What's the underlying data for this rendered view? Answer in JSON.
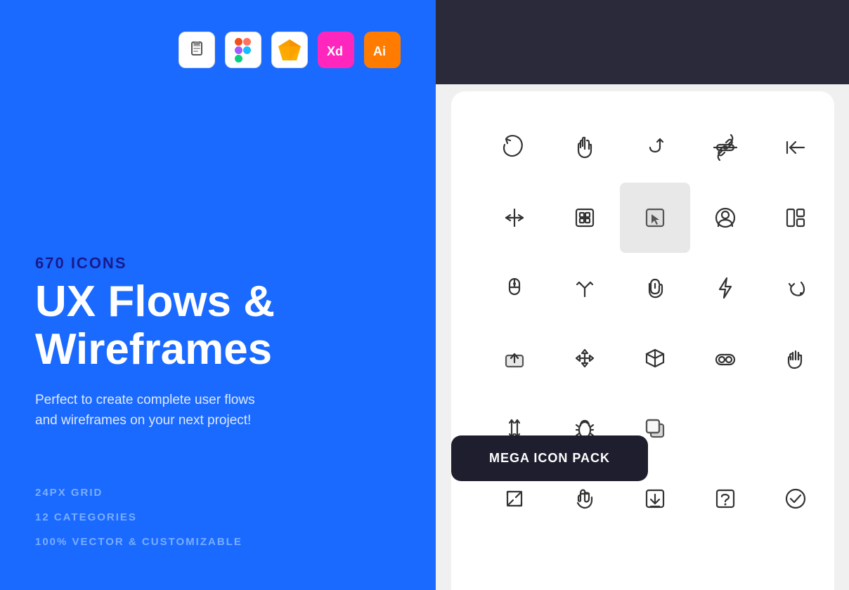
{
  "left": {
    "icon_count": "670 Icons",
    "title_line1": "UX Flows &",
    "title_line2": "Wireframes",
    "subtitle": "Perfect to create complete user flows\nand wireframes on your next project!",
    "stats": [
      "24px Grid",
      "12 Categories",
      "100% Vector & Customizable"
    ]
  },
  "app_icons": [
    {
      "name": "craft",
      "label": "🪣",
      "bg": "#ffffff",
      "color": "#333"
    },
    {
      "name": "figma",
      "label": "figma",
      "bg": "#ffffff",
      "color": "#333"
    },
    {
      "name": "sketch",
      "label": "sketch",
      "bg": "#ffffff",
      "color": "#333"
    },
    {
      "name": "xd",
      "label": "Xd",
      "bg": "#ff26be",
      "color": "#ffffff"
    },
    {
      "name": "ai",
      "label": "Ai",
      "bg": "#ff7c00",
      "color": "#ffffff"
    }
  ],
  "badge": {
    "text": "MEGA ICON PACK"
  },
  "icons": [
    "rotate",
    "hand-pointer",
    "undo-u",
    "link",
    "back-arrow",
    "compress",
    "component",
    "cursor-box",
    "user-circle",
    "layout-grid",
    "mouse",
    "fork-arrow",
    "finger-scroll",
    "lightning",
    "undo-return",
    "upload-box",
    "move-arrows",
    "cube",
    "vr-headset",
    "stop-hand",
    "height-adjust",
    "bug",
    "square-copy",
    "expand-frame",
    "hand-drag",
    "download-box",
    "question-box",
    "checkmark"
  ]
}
